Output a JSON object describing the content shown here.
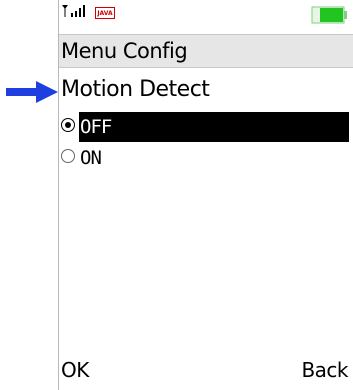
{
  "status_bar": {
    "signal_icon": "signal-strength-icon",
    "java_badge": "JAVA",
    "battery_icon": "battery-icon",
    "battery_color": "#22c422"
  },
  "title_bar": {
    "title": "Menu Config"
  },
  "pointer": {
    "icon": "arrow-right-icon",
    "color": "#1f3fe0"
  },
  "setting": {
    "heading": "Motion Detect",
    "options": [
      {
        "label": "OFF",
        "selected": true
      },
      {
        "label": "ON",
        "selected": false
      }
    ]
  },
  "softkeys": {
    "left": "OK",
    "right": "Back"
  }
}
